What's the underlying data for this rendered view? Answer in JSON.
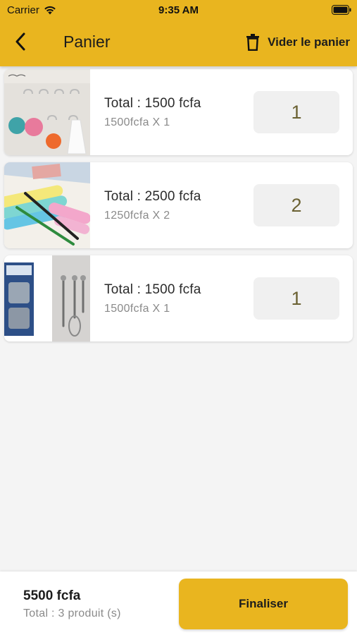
{
  "status_bar": {
    "carrier": "Carrier",
    "time": "9:35 AM"
  },
  "header": {
    "title": "Panier",
    "clear_label": "Vider le panier",
    "accent_color": "#e9b51f"
  },
  "cart_items": [
    {
      "total": "Total : 1500 fcfa",
      "unit_line": "1500fcfa X 1",
      "quantity": "1",
      "thumbnail_icon": "wall-hooks-photo"
    },
    {
      "total": "Total : 2500 fcfa",
      "unit_line": "1250fcfa X 2",
      "quantity": "2",
      "thumbnail_icon": "toothbrush-cases-photo"
    },
    {
      "total": "Total : 1500 fcfa",
      "unit_line": "1500fcfa X 1",
      "quantity": "1",
      "thumbnail_icon": "kitchen-hooks-photo"
    }
  ],
  "footer": {
    "amount": "5500 fcfa",
    "count_label": "Total : 3 produit (s)",
    "finalize_label": "Finaliser"
  }
}
